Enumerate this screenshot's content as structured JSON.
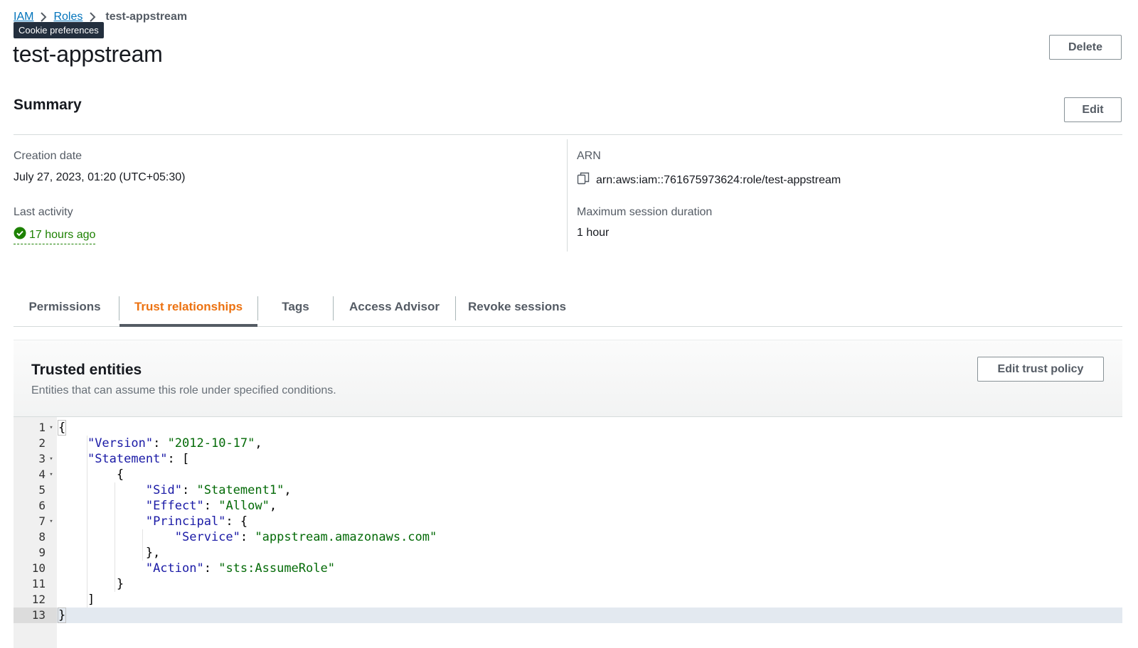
{
  "breadcrumb": {
    "items": [
      "IAM",
      "Roles"
    ],
    "current": "test-appstream"
  },
  "tooltip": {
    "text": "Cookie preferences"
  },
  "page": {
    "title": "test-appstream"
  },
  "buttons": {
    "delete": "Delete",
    "edit": "Edit",
    "edit_trust_policy": "Edit trust policy"
  },
  "summary": {
    "title": "Summary",
    "creation_date_label": "Creation date",
    "creation_date_value": "July 27, 2023, 01:20 (UTC+05:30)",
    "last_activity_label": "Last activity",
    "last_activity_value": "17 hours ago",
    "arn_label": "ARN",
    "arn_value": "arn:aws:iam::761675973624:role/test-appstream",
    "max_session_label": "Maximum session duration",
    "max_session_value": "1 hour"
  },
  "tabs": [
    {
      "label": "Permissions"
    },
    {
      "label": "Trust relationships",
      "active": true
    },
    {
      "label": "Tags"
    },
    {
      "label": "Access Advisor"
    },
    {
      "label": "Revoke sessions"
    }
  ],
  "trusted_entities": {
    "title": "Trusted entities",
    "description": "Entities that can assume this role under specified conditions."
  },
  "policy": {
    "version_key": "\"Version\"",
    "version_value": "\"2012-10-17\"",
    "statement_key": "\"Statement\"",
    "sid_key": "\"Sid\"",
    "sid_value": "\"Statement1\"",
    "effect_key": "\"Effect\"",
    "effect_value": "\"Allow\"",
    "principal_key": "\"Principal\"",
    "service_key": "\"Service\"",
    "service_value": "\"appstream.amazonaws.com\"",
    "action_key": "\"Action\"",
    "action_value": "\"sts:AssumeRole\"",
    "line_numbers": [
      "1",
      "2",
      "3",
      "4",
      "5",
      "6",
      "7",
      "8",
      "9",
      "10",
      "11",
      "12",
      "13"
    ]
  },
  "colors": {
    "accent": "#ec7211",
    "link": "#0073bb",
    "success": "#1d8102"
  },
  "icons": {
    "breadcrumb_separator": "chevron-right-icon",
    "status": "success-check-icon",
    "copy": "copy-icon",
    "fold": "fold-arrow-icon"
  }
}
